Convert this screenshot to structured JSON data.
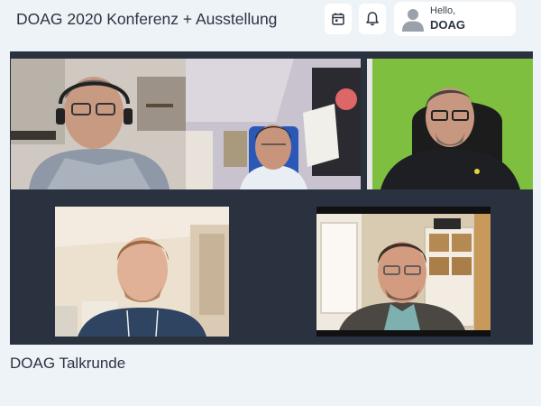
{
  "header": {
    "title": "DOAG 2020 Konferenz + Ausstellung",
    "calendar_icon": "calendar-icon",
    "notification_icon": "bell-icon"
  },
  "user": {
    "greeting": "Hello,",
    "name": "DOAG",
    "avatar_icon": "user-avatar-icon"
  },
  "session": {
    "title": "DOAG Talkrunde"
  },
  "video": {
    "participants_shown": 5
  },
  "colors": {
    "page_bg": "#eef3f8",
    "stage_bg": "#2a313f",
    "text": "#2b3441",
    "green_screen": "#7fbf3f"
  }
}
